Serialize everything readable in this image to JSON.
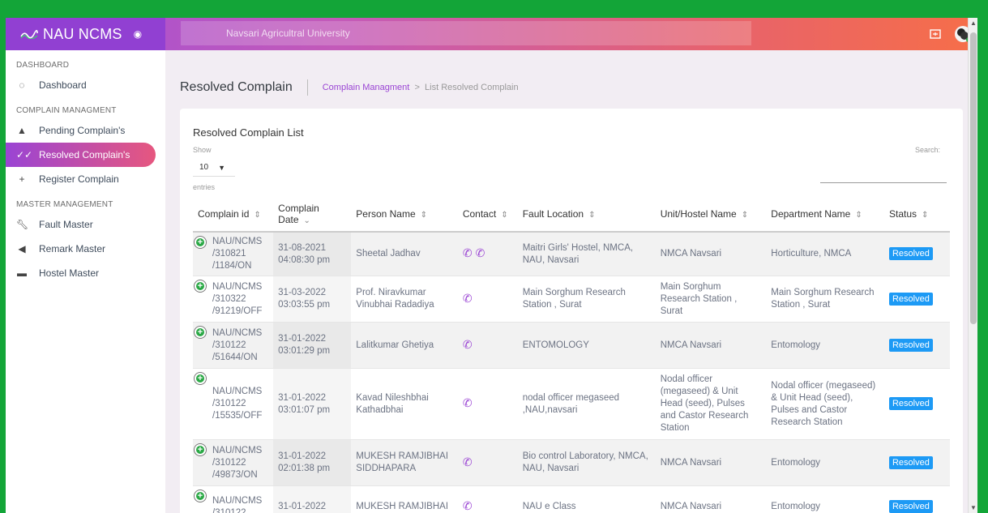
{
  "header": {
    "app_name": "NAU NCMS",
    "university": "Navsari Agricultral University"
  },
  "sidebar": {
    "sections": [
      {
        "title": "DASHBOARD"
      },
      {
        "title": "COMPLAIN MANAGMENT"
      },
      {
        "title": "MASTER MANAGEMENT"
      }
    ],
    "items": [
      {
        "label": "Dashboard",
        "icon": "palette-icon"
      },
      {
        "label": "Pending Complain's",
        "icon": "warning-icon"
      },
      {
        "label": "Resolved Complain's",
        "icon": "double-check-icon"
      },
      {
        "label": "Register Complain",
        "icon": "plus-icon"
      },
      {
        "label": "Fault Master",
        "icon": "wrench-icon"
      },
      {
        "label": "Remark Master",
        "icon": "reply-icon"
      },
      {
        "label": "Hostel Master",
        "icon": "bed-icon"
      }
    ]
  },
  "page": {
    "title": "Resolved Complain",
    "breadcrumb_link": "Complain Managment",
    "breadcrumb_sep": ">",
    "breadcrumb_current": "List Resolved Complain"
  },
  "card": {
    "title": "Resolved Complain List",
    "show_label": "Show",
    "page_length": "10",
    "entries_label": "entries",
    "search_label": "Search:"
  },
  "table": {
    "headers": [
      "Complain id",
      "Complain Date",
      "Person Name",
      "Contact",
      "Fault Location",
      "Unit/Hostel Name",
      "Department Name",
      "Status"
    ],
    "rows": [
      {
        "id": "NAU/NCMS /310821 /1184/ON",
        "date": "31-08-2021 04:08:30 pm",
        "person": "Sheetal Jadhav",
        "location": "Maitri Girls' Hostel, NMCA, NAU, Navsari",
        "unit": "NMCA Navsari",
        "dept": "Horticulture, NMCA",
        "status": "Resolved",
        "phones": 2
      },
      {
        "id": "NAU/NCMS /310322 /91219/OFF",
        "date": "31-03-2022 03:03:55 pm",
        "person": "Prof. Niravkumar Vinubhai Radadiya",
        "location": "Main Sorghum Research Station , Surat",
        "unit": "Main Sorghum Research Station , Surat",
        "dept": "Main Sorghum Research Station , Surat",
        "status": "Resolved",
        "phones": 1
      },
      {
        "id": "NAU/NCMS /310122 /51644/ON",
        "date": "31-01-2022 03:01:29 pm",
        "person": "Lalitkumar Ghetiya",
        "location": "ENTOMOLOGY",
        "unit": "NMCA Navsari",
        "dept": "Entomology",
        "status": "Resolved",
        "phones": 1
      },
      {
        "id": "NAU/NCMS /310122 /15535/OFF",
        "date": "31-01-2022 03:01:07 pm",
        "person": "Kavad Nileshbhai Kathadbhai",
        "location": "nodal officer megaseed ,NAU,navsari",
        "unit": "Nodal officer (megaseed) & Unit Head (seed), Pulses and Castor Research Station",
        "dept": "Nodal officer (megaseed) & Unit Head (seed), Pulses and Castor Research Station",
        "status": "Resolved",
        "phones": 1
      },
      {
        "id": "NAU/NCMS /310122 /49873/ON",
        "date": "31-01-2022 02:01:38 pm",
        "person": "MUKESH RAMJIBHAI SIDDHAPARA",
        "location": "Bio control Laboratory, NMCA, NAU, Navsari",
        "unit": "NMCA Navsari",
        "dept": "Entomology",
        "status": "Resolved",
        "phones": 1
      },
      {
        "id": "NAU/NCMS /310122",
        "date": "31-01-2022",
        "person": "MUKESH RAMJIBHAI",
        "location": "NAU e Class",
        "unit": "NMCA Navsari",
        "dept": "Entomology",
        "status": "Resolved",
        "phones": 1
      }
    ]
  },
  "colors": {
    "accent": "#9a44d4",
    "status_badge": "#1d9af5",
    "expand_button": "#2aa845",
    "outer_border": "#13a538"
  }
}
